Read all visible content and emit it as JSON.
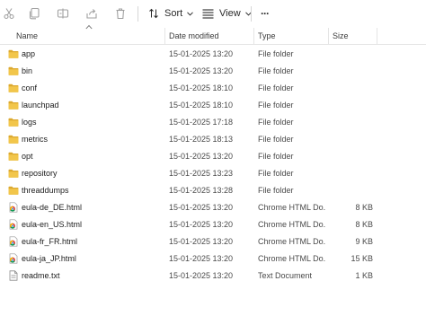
{
  "toolbar": {
    "sort_label": "Sort",
    "view_label": "View",
    "more_label": "···"
  },
  "columns": {
    "name": "Name",
    "date_modified": "Date modified",
    "type": "Type",
    "size": "Size"
  },
  "rows": [
    {
      "name": "app",
      "date": "15-01-2025 13:20",
      "type": "File folder",
      "size": "",
      "icon": "folder-icon"
    },
    {
      "name": "bin",
      "date": "15-01-2025 13:20",
      "type": "File folder",
      "size": "",
      "icon": "folder-icon"
    },
    {
      "name": "conf",
      "date": "15-01-2025 18:10",
      "type": "File folder",
      "size": "",
      "icon": "folder-icon"
    },
    {
      "name": "launchpad",
      "date": "15-01-2025 18:10",
      "type": "File folder",
      "size": "",
      "icon": "folder-icon"
    },
    {
      "name": "logs",
      "date": "15-01-2025 17:18",
      "type": "File folder",
      "size": "",
      "icon": "folder-icon"
    },
    {
      "name": "metrics",
      "date": "15-01-2025 18:13",
      "type": "File folder",
      "size": "",
      "icon": "folder-icon"
    },
    {
      "name": "opt",
      "date": "15-01-2025 13:20",
      "type": "File folder",
      "size": "",
      "icon": "folder-icon"
    },
    {
      "name": "repository",
      "date": "15-01-2025 13:23",
      "type": "File folder",
      "size": "",
      "icon": "folder-icon"
    },
    {
      "name": "threaddumps",
      "date": "15-01-2025 13:28",
      "type": "File folder",
      "size": "",
      "icon": "folder-icon"
    },
    {
      "name": "eula-de_DE.html",
      "date": "15-01-2025 13:20",
      "type": "Chrome HTML Do...",
      "size": "8 KB",
      "icon": "chrome-html-icon"
    },
    {
      "name": "eula-en_US.html",
      "date": "15-01-2025 13:20",
      "type": "Chrome HTML Do...",
      "size": "8 KB",
      "icon": "chrome-html-icon"
    },
    {
      "name": "eula-fr_FR.html",
      "date": "15-01-2025 13:20",
      "type": "Chrome HTML Do...",
      "size": "9 KB",
      "icon": "chrome-html-icon"
    },
    {
      "name": "eula-ja_JP.html",
      "date": "15-01-2025 13:20",
      "type": "Chrome HTML Do...",
      "size": "15 KB",
      "icon": "chrome-html-icon"
    },
    {
      "name": "readme.txt",
      "date": "15-01-2025 13:20",
      "type": "Text Document",
      "size": "1 KB",
      "icon": "text-file-icon"
    }
  ],
  "colors": {
    "folder": "#f2c64b",
    "folder_dark": "#dca92f",
    "disabled_icon": "#a0a0a0",
    "header_border": "#e5e5e5"
  }
}
